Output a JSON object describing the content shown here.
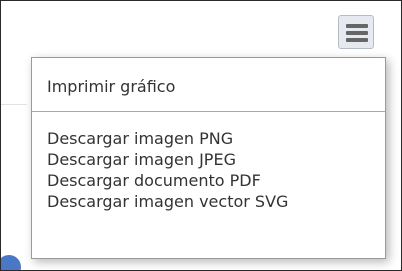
{
  "export_menu": {
    "button_icon": "hamburger-menu-icon",
    "print_label": "Imprimir gráfico",
    "items": [
      {
        "label": "Descargar imagen PNG"
      },
      {
        "label": "Descargar imagen JPEG"
      },
      {
        "label": "Descargar documento PDF"
      },
      {
        "label": "Descargar imagen vector SVG"
      }
    ]
  },
  "colors": {
    "menu_text": "#333333",
    "button_background": "#e6eaf0",
    "icon": "#666666",
    "series_color": "#4a78c6"
  }
}
